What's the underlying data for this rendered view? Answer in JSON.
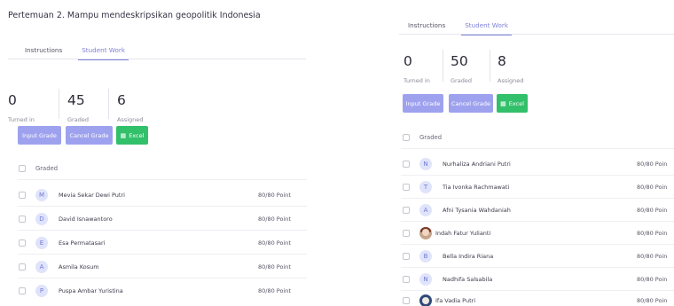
{
  "left": {
    "title": "Pertemuan 2. Mampu mendeskripsikan geopolitik Indonesia",
    "tabs": [
      {
        "label": "Instructions"
      },
      {
        "label": "Student Work"
      }
    ],
    "stats": [
      {
        "value": "0",
        "label": "Turned in"
      },
      {
        "value": "45",
        "label": "Graded"
      },
      {
        "value": "6",
        "label": "Assigned"
      }
    ],
    "buttons": {
      "input_grade": "Input Grade",
      "cancel_grade": "Cancel Grade",
      "excel": "Excel"
    },
    "graded_label": "Graded",
    "students": [
      {
        "initial": "M",
        "name": "Mevia Sekar Dewi Putri",
        "points": "80/80 Point"
      },
      {
        "initial": "D",
        "name": "David Isnawantoro",
        "points": "80/80 Point"
      },
      {
        "initial": "E",
        "name": "Esa Permatasari",
        "points": "80/80 Point"
      },
      {
        "initial": "A",
        "name": "Asmila Kosum",
        "points": "80/80 Point"
      },
      {
        "initial": "P",
        "name": "Puspa Ambar Yuristina",
        "points": "80/80 Point"
      }
    ]
  },
  "right": {
    "tabs": [
      {
        "label": "Instructions"
      },
      {
        "label": "Student Work"
      }
    ],
    "stats": [
      {
        "value": "0",
        "label": "Turned in"
      },
      {
        "value": "50",
        "label": "Graded"
      },
      {
        "value": "8",
        "label": "Assigned"
      }
    ],
    "buttons": {
      "input_grade": "Input Grade",
      "cancel_grade": "Cancel Grade",
      "excel": "Excel"
    },
    "graded_label": "Graded",
    "students": [
      {
        "initial": "N",
        "name": "Nurhaliza Andriani Putri",
        "points": "80/80 Poin"
      },
      {
        "initial": "T",
        "name": "Tia Ivonka Rachmawati",
        "points": "80/80 Poin"
      },
      {
        "initial": "A",
        "name": "Afni Tysania Wahdaniah",
        "points": "80/80 Poin"
      },
      {
        "initial": "",
        "name": "Indah Fatur Yulianti",
        "points": "80/80 Poin"
      },
      {
        "initial": "B",
        "name": "Bella Indira Riana",
        "points": "80/80 Poin"
      },
      {
        "initial": "N",
        "name": "Nadhifa Salsabila",
        "points": "80/80 Poin"
      },
      {
        "initial": "",
        "name": "Ifa Vadia Putri",
        "points": "80/80 Poin"
      }
    ]
  },
  "colors": {
    "accent": "#7d7fd6",
    "button_purple": "#9ea2ee",
    "button_green": "#32c06a"
  },
  "icons": {
    "excel": "excel-file-icon",
    "photo_avatar": "user-photo-avatar"
  }
}
